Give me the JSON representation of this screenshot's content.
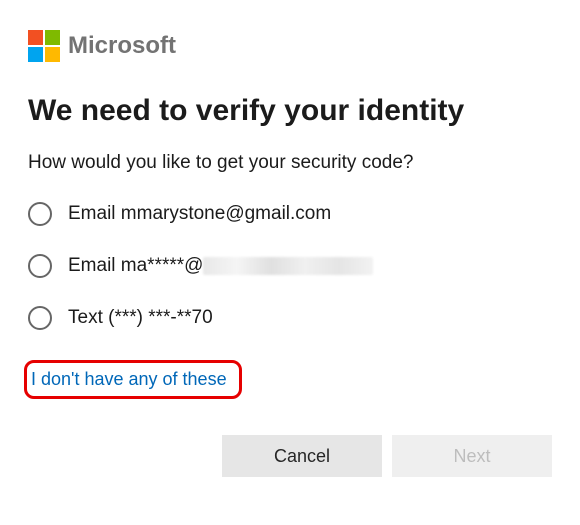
{
  "brand": {
    "name": "Microsoft",
    "colors": {
      "red": "#f25022",
      "green": "#7fba00",
      "blue": "#00a4ef",
      "yellow": "#ffb900"
    }
  },
  "title": "We need to verify your identity",
  "subtitle": "How would you like to get your security code?",
  "options": [
    {
      "label": "Email mmarystone@gmail.com"
    },
    {
      "label_prefix": "Email ma*****@",
      "obscured": true
    },
    {
      "label": "Text (***) ***-**70"
    }
  ],
  "no_access_link": "I don't have any of these",
  "buttons": {
    "cancel": "Cancel",
    "next": "Next"
  },
  "link_color": "#0067b8",
  "highlight_color": "#e60000"
}
